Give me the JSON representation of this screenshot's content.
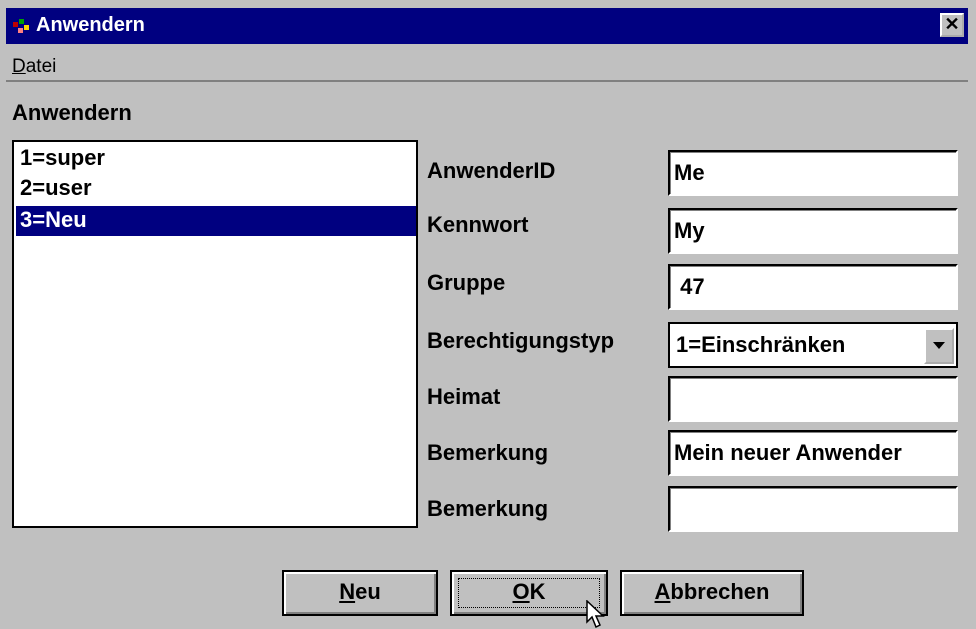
{
  "window": {
    "title": "Anwendern",
    "close_glyph": "✕"
  },
  "menu": {
    "items": [
      {
        "accel": "D",
        "rest": "atei"
      }
    ]
  },
  "section_title": "Anwendern",
  "users_list": [
    {
      "label": "1=super",
      "selected": false
    },
    {
      "label": "2=user",
      "selected": false
    },
    {
      "label": "3=Neu",
      "selected": true
    }
  ],
  "fields": {
    "anwender_id": {
      "label": "AnwenderID",
      "value": "Me"
    },
    "kennwort": {
      "label": "Kennwort",
      "value": "My"
    },
    "gruppe": {
      "label": "Gruppe",
      "value": " 47"
    },
    "berechtigungstyp": {
      "label": "Berechtigungstyp",
      "value": "1=Einschränken"
    },
    "heimat": {
      "label": "Heimat",
      "value": ""
    },
    "bemerkung1": {
      "label": "Bemerkung",
      "value": "Mein neuer Anwender"
    },
    "bemerkung2": {
      "label": "Bemerkung",
      "value": ""
    }
  },
  "buttons": {
    "neu": {
      "accel": "N",
      "rest": "eu"
    },
    "ok": {
      "accel": "O",
      "rest": "K"
    },
    "abbrechen": {
      "accel": "A",
      "rest": "bbrechen"
    }
  },
  "icons": {
    "app": "app-icon",
    "dropdown": "dropdown-arrow-icon",
    "cursor": "mouse-cursor-icon"
  },
  "colors": {
    "titlebar": "#000080",
    "face": "#c0c0c0",
    "selection": "#000080"
  }
}
